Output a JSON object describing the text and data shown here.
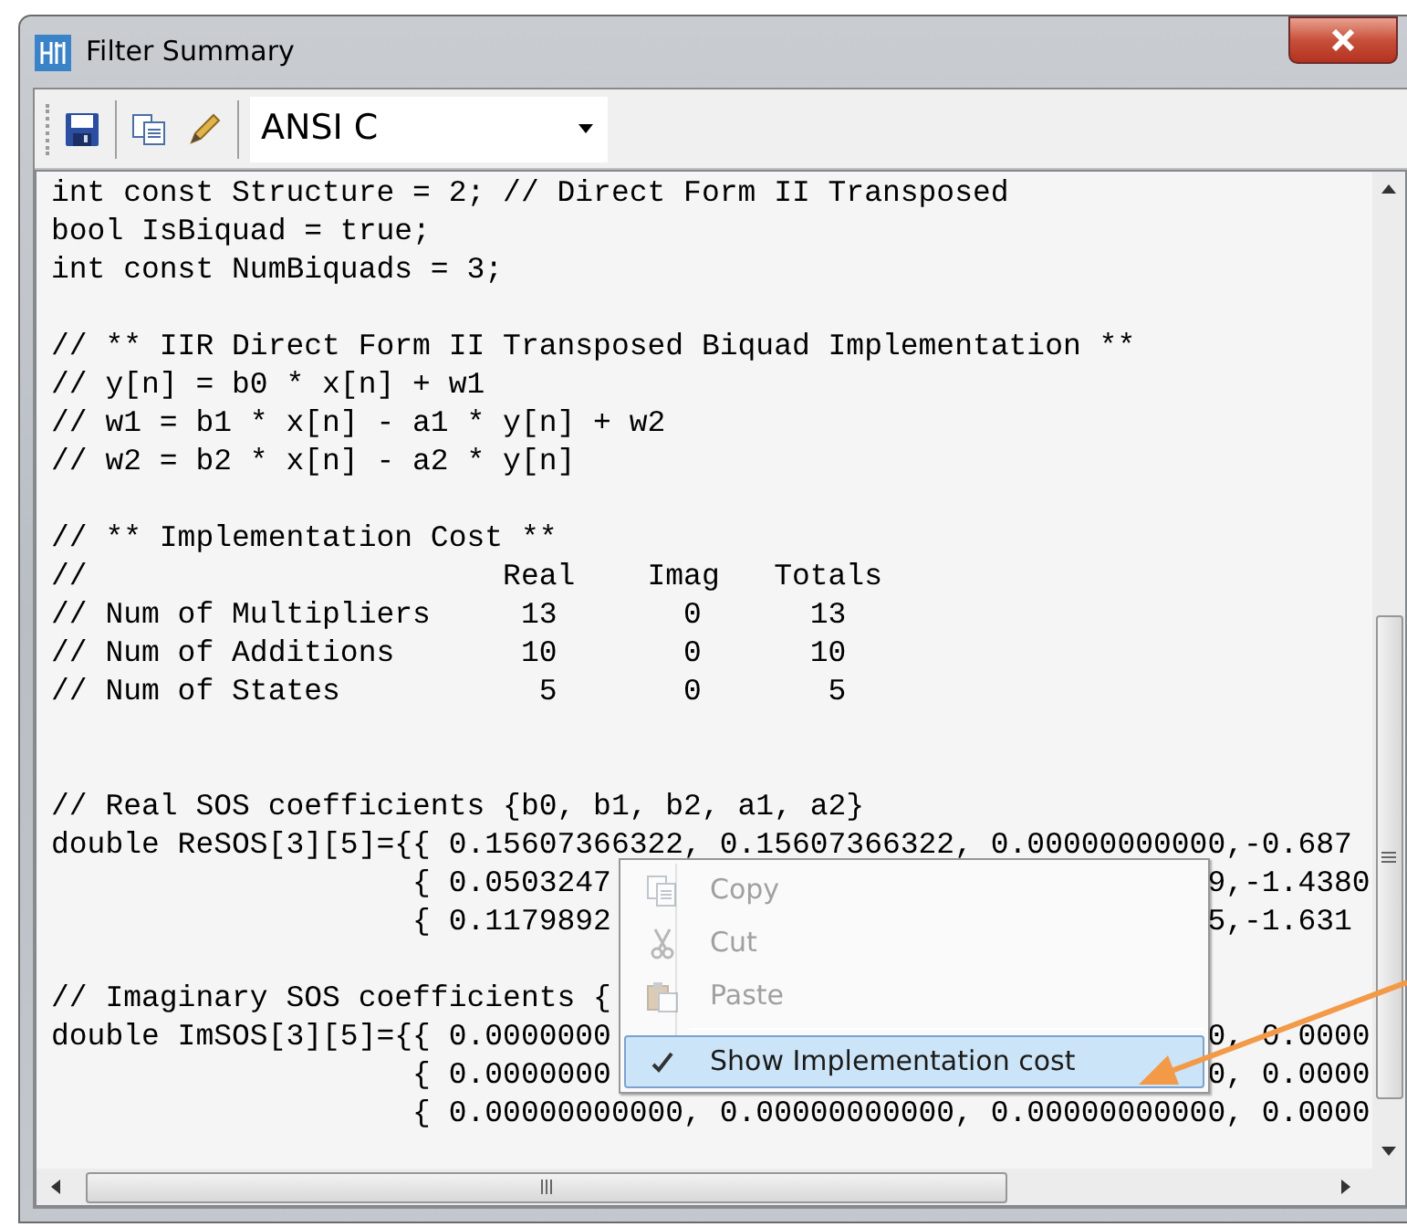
{
  "window": {
    "title": "Filter Summary"
  },
  "toolbar": {
    "format": "ANSI C"
  },
  "code_lines": [
    {
      "kind": "text",
      "text": "int const Structure = 2; // Direct Form II Transposed"
    },
    {
      "kind": "text",
      "text": "bool IsBiquad = true;"
    },
    {
      "kind": "text",
      "text": "int const NumBiquads = 3;"
    },
    {
      "kind": "blank"
    },
    {
      "kind": "text",
      "text": "// ** IIR Direct Form II Transposed Biquad Implementation **"
    },
    {
      "kind": "text",
      "text": "// y[n] = b0 * x[n] + w1"
    },
    {
      "kind": "text",
      "text": "// w1 = b1 * x[n] - a1 * y[n] + w2"
    },
    {
      "kind": "text",
      "text": "// w2 = b2 * x[n] - a2 * y[n]"
    },
    {
      "kind": "blank"
    },
    {
      "kind": "text",
      "text": "// ** Implementation Cost **"
    },
    {
      "kind": "text",
      "text": "//                       Real    Imag   Totals"
    },
    {
      "kind": "text",
      "text": "// Num of Multipliers     13       0      13"
    },
    {
      "kind": "text",
      "text": "// Num of Additions       10       0      10"
    },
    {
      "kind": "text",
      "text": "// Num of States           5       0       5"
    },
    {
      "kind": "blank"
    },
    {
      "kind": "blank"
    },
    {
      "kind": "text",
      "text": "// Real SOS coefficients {b0, b1, b2, a1, a2}"
    },
    {
      "kind": "text",
      "text": "double ReSOS[3][5]={{ 0.15607366322, 0.15607366322, 0.00000000000,-0.687"
    },
    {
      "kind": "split",
      "left": "                    { 0.0503247",
      "right": "9,-1.4380"
    },
    {
      "kind": "split",
      "left": "                    { 0.1179892",
      "right": "5,-1.631"
    },
    {
      "kind": "blank"
    },
    {
      "kind": "text",
      "text": "// Imaginary SOS coefficients {"
    },
    {
      "kind": "split",
      "left": "double ImSOS[3][5]={{ 0.0000000",
      "right": "0, 0.0000"
    },
    {
      "kind": "split",
      "left": "                    { 0.0000000",
      "right": "0, 0.0000"
    },
    {
      "kind": "text",
      "text": "                    { 0.00000000000, 0.00000000000, 0.00000000000, 0.0000"
    }
  ],
  "context_menu": [
    {
      "kind": "item",
      "label": "Copy",
      "disabled": true,
      "checked": false,
      "selected": false
    },
    {
      "kind": "item",
      "label": "Cut",
      "disabled": true,
      "checked": false,
      "selected": false
    },
    {
      "kind": "item",
      "label": "Paste",
      "disabled": true,
      "checked": false,
      "selected": false
    },
    {
      "kind": "separator"
    },
    {
      "kind": "item",
      "label": "Show Implementation cost",
      "disabled": false,
      "checked": true,
      "selected": true
    }
  ]
}
